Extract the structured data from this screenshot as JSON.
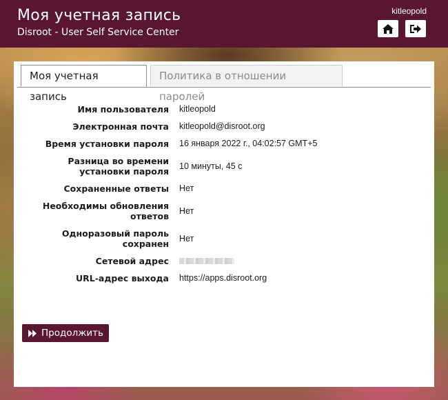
{
  "header": {
    "title": "Моя учетная запись",
    "subtitle": "Disroot - User Self Service Center",
    "username": "kitleopold",
    "home_icon": "home-icon",
    "logout_icon": "sign-out-icon",
    "color": "#591631"
  },
  "tabs": [
    {
      "label": "Моя учетная запись",
      "active": true
    },
    {
      "label": "Политика в отношении паролей",
      "active": false
    }
  ],
  "fields": [
    {
      "label": "Имя пользователя",
      "value": "kitleopold"
    },
    {
      "label": "Электронная почта",
      "value": "kitleopold@disroot.org"
    },
    {
      "label": "Время установки пароля",
      "value": "16 января 2022 г., 04:02:57 GMT+5"
    },
    {
      "label": "Разница во времени установки пароля",
      "value": "10 минуты, 45 с"
    },
    {
      "label": "Сохраненные ответы",
      "value": "Нет"
    },
    {
      "label": "Необходимы обновления ответов",
      "value": "Нет"
    },
    {
      "label": "Одноразовый пароль сохранен",
      "value": "Нет"
    },
    {
      "label": "Сетевой адрес",
      "value": ""
    },
    {
      "label": "URL-адрес выхода",
      "value": "https://apps.disroot.org"
    }
  ],
  "continue_button": {
    "label": "Продолжить",
    "icon": "fast-forward-icon"
  }
}
